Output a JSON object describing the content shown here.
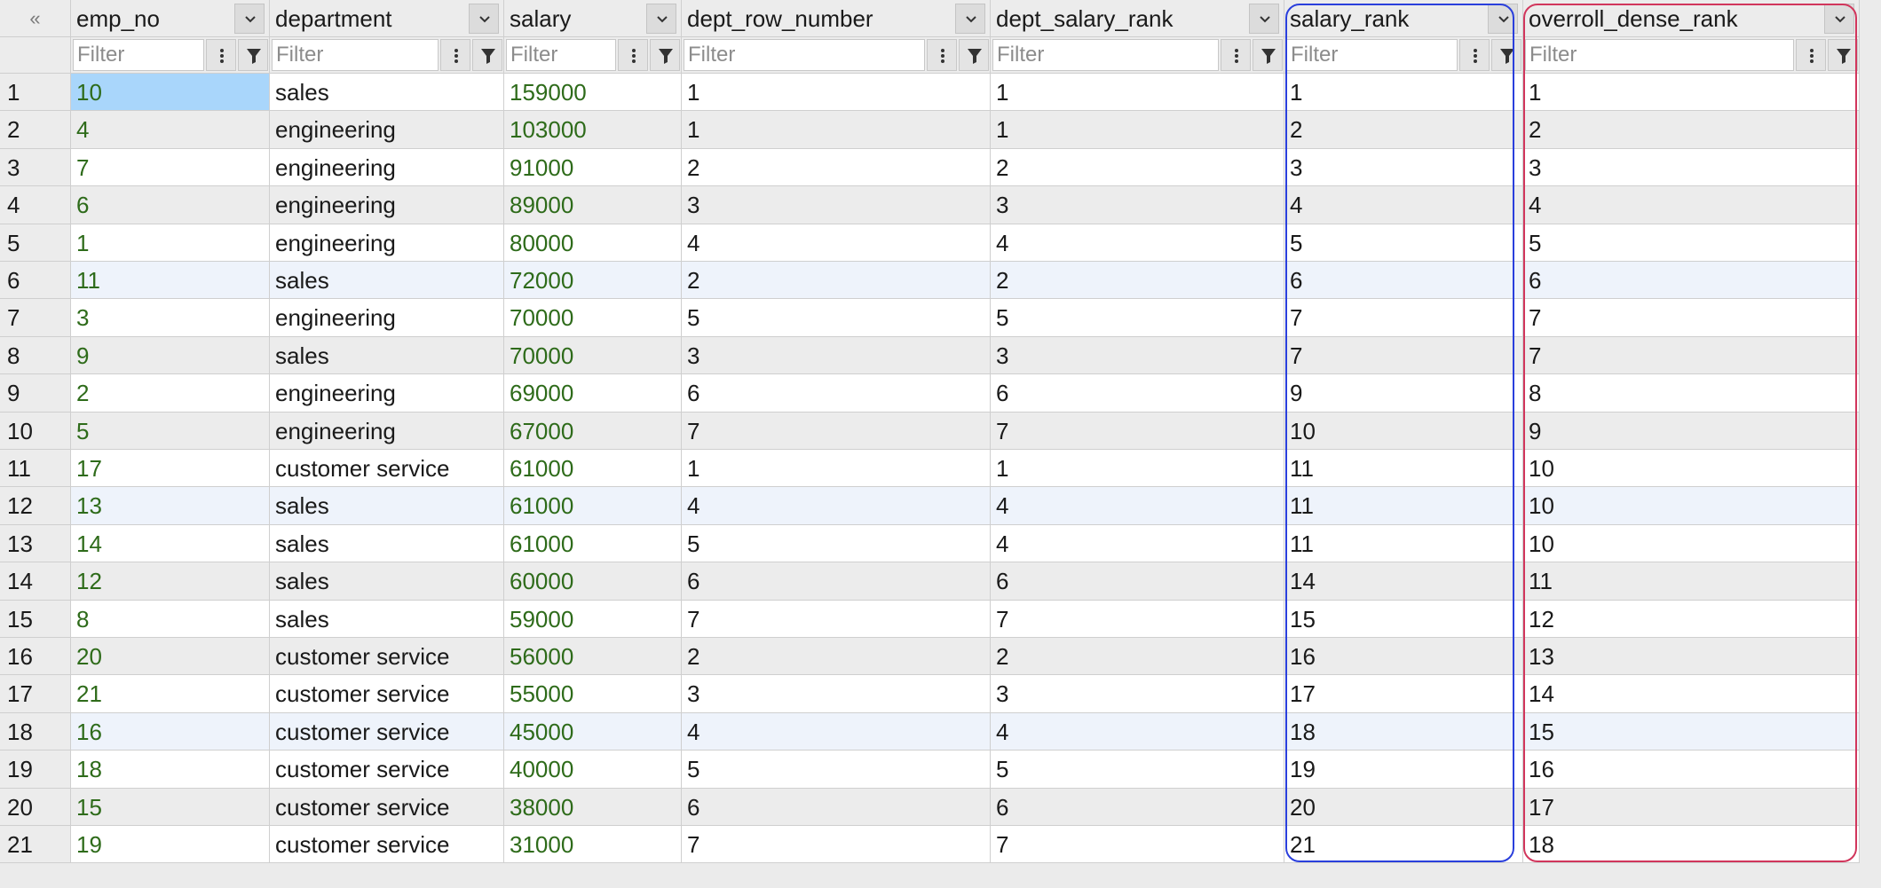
{
  "corner_label": "«",
  "columns": [
    "emp_no",
    "department",
    "salary",
    "dept_row_number",
    "dept_salary_rank",
    "salary_rank",
    "overroll_dense_rank"
  ],
  "filter_placeholder": "Filter",
  "rows": [
    [
      "1",
      "10",
      "sales",
      "159000",
      "1",
      "1",
      "1",
      "1"
    ],
    [
      "2",
      "4",
      "engineering",
      "103000",
      "1",
      "1",
      "2",
      "2"
    ],
    [
      "3",
      "7",
      "engineering",
      "91000",
      "2",
      "2",
      "3",
      "3"
    ],
    [
      "4",
      "6",
      "engineering",
      "89000",
      "3",
      "3",
      "4",
      "4"
    ],
    [
      "5",
      "1",
      "engineering",
      "80000",
      "4",
      "4",
      "5",
      "5"
    ],
    [
      "6",
      "11",
      "sales",
      "72000",
      "2",
      "2",
      "6",
      "6"
    ],
    [
      "7",
      "3",
      "engineering",
      "70000",
      "5",
      "5",
      "7",
      "7"
    ],
    [
      "8",
      "9",
      "sales",
      "70000",
      "3",
      "3",
      "7",
      "7"
    ],
    [
      "9",
      "2",
      "engineering",
      "69000",
      "6",
      "6",
      "9",
      "8"
    ],
    [
      "10",
      "5",
      "engineering",
      "67000",
      "7",
      "7",
      "10",
      "9"
    ],
    [
      "11",
      "17",
      "customer service",
      "61000",
      "1",
      "1",
      "11",
      "10"
    ],
    [
      "12",
      "13",
      "sales",
      "61000",
      "4",
      "4",
      "11",
      "10"
    ],
    [
      "13",
      "14",
      "sales",
      "61000",
      "5",
      "4",
      "11",
      "10"
    ],
    [
      "14",
      "12",
      "sales",
      "60000",
      "6",
      "6",
      "14",
      "11"
    ],
    [
      "15",
      "8",
      "sales",
      "59000",
      "7",
      "7",
      "15",
      "12"
    ],
    [
      "16",
      "20",
      "customer service",
      "56000",
      "2",
      "2",
      "16",
      "13"
    ],
    [
      "17",
      "21",
      "customer service",
      "55000",
      "3",
      "3",
      "17",
      "14"
    ],
    [
      "18",
      "16",
      "customer service",
      "45000",
      "4",
      "4",
      "18",
      "15"
    ],
    [
      "19",
      "18",
      "customer service",
      "40000",
      "5",
      "5",
      "19",
      "16"
    ],
    [
      "20",
      "15",
      "customer service",
      "38000",
      "6",
      "6",
      "20",
      "17"
    ],
    [
      "21",
      "19",
      "customer service",
      "31000",
      "7",
      "7",
      "21",
      "18"
    ]
  ],
  "selected_cell": {
    "row": 1,
    "column": "emp_no"
  },
  "highlighted_rows": [
    6,
    12,
    18
  ],
  "colors": {
    "numeric_text": "#2e6b1a",
    "selection": "#a9d6fb",
    "highlight_blue": "#2a3fdc",
    "highlight_red": "#d1365c"
  }
}
